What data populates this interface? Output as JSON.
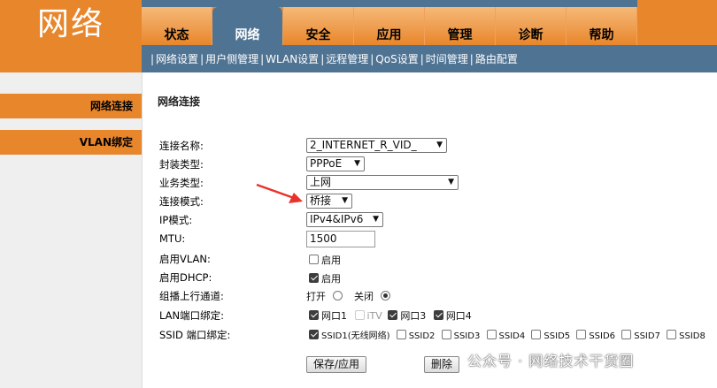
{
  "logo": "网络",
  "tabs": [
    "状态",
    "网络",
    "安全",
    "应用",
    "管理",
    "诊断",
    "帮助"
  ],
  "subnav": [
    "网络设置",
    "用户侧管理",
    "WLAN设置",
    "远程管理",
    "QoS设置",
    "时间管理",
    "路由配置"
  ],
  "sidebar": [
    "网络连接",
    "VLAN绑定"
  ],
  "section_title": "网络连接",
  "form": {
    "conn_name_label": "连接名称:",
    "conn_name_value": "2_INTERNET_R_VID_",
    "encap_label": "封装类型:",
    "encap_value": "PPPoE",
    "service_label": "业务类型:",
    "service_value": "上网",
    "mode_label": "连接模式:",
    "mode_value": "桥接",
    "ip_label": "IP模式:",
    "ip_value": "IPv4&IPv6",
    "mtu_label": "MTU:",
    "mtu_value": "1500",
    "vlan_label": "启用VLAN:",
    "vlan_check": "启用",
    "dhcp_label": "启用DHCP:",
    "dhcp_check": "启用",
    "mcast_label": "组播上行通道:",
    "mcast_on": "打开",
    "mcast_off": "关闭",
    "lan_label": "LAN端口绑定:",
    "lan_ports": [
      "网口1",
      "iTV",
      "网口3",
      "网口4"
    ],
    "ssid_label": "SSID 端口绑定:",
    "ssids": [
      "SSID1(无线网络)",
      "SSID2",
      "SSID3",
      "SSID4",
      "SSID5",
      "SSID6",
      "SSID7",
      "SSID8"
    ]
  },
  "buttons": {
    "save": "保存/应用",
    "delete": "删除"
  },
  "watermark": "公众号 · 网络技术干货圈",
  "colors": {
    "orange": "#e8862b",
    "blue": "#4f7393",
    "arrow": "#e8322b"
  }
}
